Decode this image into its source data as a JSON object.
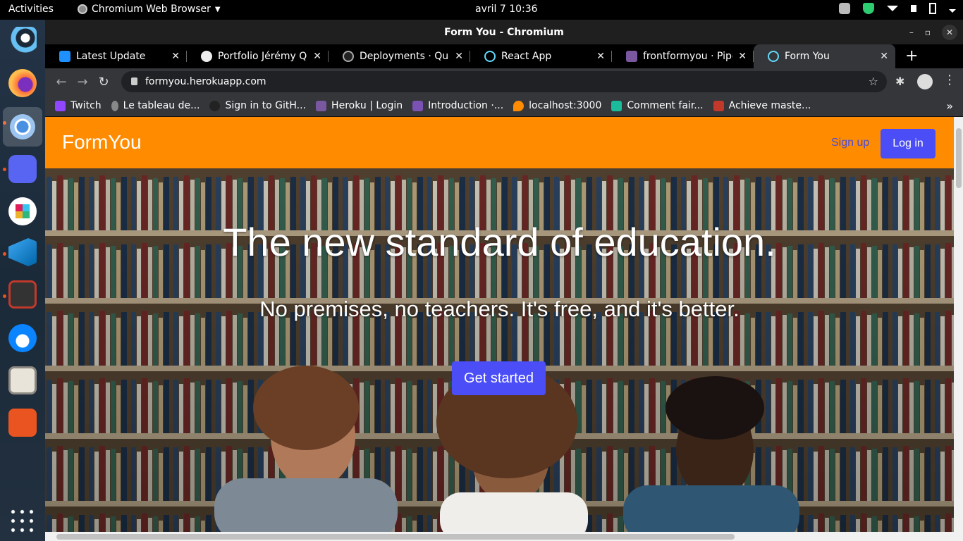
{
  "topbar": {
    "activities": "Activities",
    "app_name": "Chromium Web Browser",
    "clock": "avril 7  10:36"
  },
  "dock": {
    "apps": [
      "steam-icon",
      "firefox-icon",
      "chromium-icon",
      "discord-icon",
      "slack-icon",
      "vscode-icon",
      "terminal-icon",
      "thunderbird-icon",
      "files-icon",
      "software-center-icon",
      "app-grid-icon"
    ]
  },
  "window": {
    "title": "Form You - Chromium"
  },
  "tabs": [
    {
      "label": "Latest Update",
      "color": "#1e90ff"
    },
    {
      "label": "Portfolio Jérémy Qu",
      "color": "#eeeeee"
    },
    {
      "label": "Deployments · Quej",
      "color": "#222222"
    },
    {
      "label": "React App",
      "color": "#61dafb"
    },
    {
      "label": "frontformyou · Pipe",
      "color": "#79589f"
    },
    {
      "label": "Form You",
      "color": "#61dafb"
    }
  ],
  "omnibox": {
    "url": "formyou.herokuapp.com"
  },
  "bookmarks": [
    {
      "label": "Twitch",
      "color": "#9146ff"
    },
    {
      "label": "Le tableau de...",
      "color": "#888888"
    },
    {
      "label": "Sign in to GitH...",
      "color": "#222222"
    },
    {
      "label": "Heroku | Login",
      "color": "#79589f"
    },
    {
      "label": "Introduction ·...",
      "color": "#7952b3"
    },
    {
      "label": "localhost:3000",
      "color": "#ff8c00"
    },
    {
      "label": "Comment fair...",
      "color": "#1abc9c"
    },
    {
      "label": "Achieve maste...",
      "color": "#c0392b"
    }
  ],
  "site": {
    "brand": "FormYou",
    "signup": "Sign up",
    "login": "Log in",
    "hero_title": "The new standard of education.",
    "hero_subtitle": "No premises, no teachers. It's free, and it's better.",
    "cta": "Get started",
    "accent": "#4b4ef7",
    "navbar_color": "#ff8c00"
  }
}
